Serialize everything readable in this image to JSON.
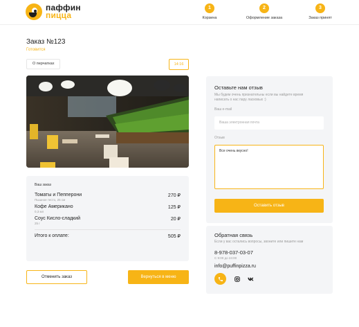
{
  "header": {
    "logo_line1": "паффин",
    "logo_line2": "пицца",
    "steps": [
      {
        "number": "1",
        "label": "Корзина"
      },
      {
        "number": "2",
        "label": "Оформление заказа"
      },
      {
        "number": "3",
        "label": "Заказ принят"
      }
    ]
  },
  "order": {
    "title": "Заказ №123",
    "status": "Готовится",
    "note_button": "О перчатках",
    "time": "14:16",
    "card_label": "Ваш заказ",
    "items": [
      {
        "name": "Томаты и Пепперони",
        "detail": "Пышное тесто, 25 см",
        "price": "270 ₽"
      },
      {
        "name": "Кофе Американо",
        "detail": "0,3 мл",
        "price": "125 ₽"
      },
      {
        "name": "Соус Кисло-сладкий",
        "detail": "25 г",
        "price": "20 ₽"
      }
    ],
    "total_label": "Итого к оплате:",
    "total_value": "505 ₽",
    "cancel_button": "Отменить заказ",
    "back_button": "Вернуться в меню"
  },
  "review": {
    "title": "Оставьте нам отзыв",
    "subtitle": "Мы будем очень признательны если вы найдете время написать о нас пару ласковых :)",
    "email_label": "Ваш e-mail",
    "email_placeholder": "Ваша электронная почта",
    "review_label": "Отзыв",
    "review_value": "Все очень вкусно!",
    "submit_button": "Оставить отзыв"
  },
  "contact": {
    "title": "Обратная связь",
    "subtitle": "Если у вас остались вопросы, звоните или пишите нам",
    "phone": "8-978-037-03-07",
    "hours": "С 9:00 до 24:00",
    "email": "info@puffinpizza.ru",
    "icons": [
      "phone-icon",
      "instagram-icon",
      "vk-icon"
    ]
  },
  "colors": {
    "accent": "#f7b416",
    "panel": "#f4f5f7"
  }
}
